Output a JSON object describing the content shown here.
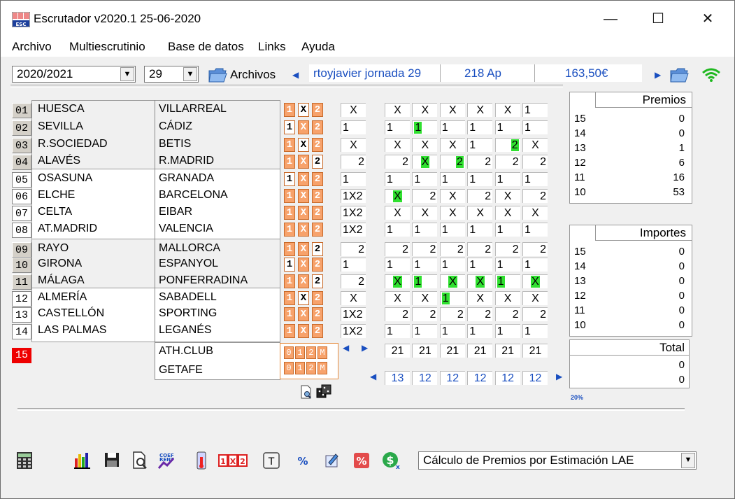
{
  "window": {
    "title": "Escrutador v2020.1 25-06-2020",
    "min": "—",
    "max": "☐",
    "close": "✕"
  },
  "menu": [
    "Archivo",
    "Multiescrutinio",
    "Base de datos",
    "Links",
    "Ayuda"
  ],
  "toolbar": {
    "season": "2020/2021",
    "round": "29",
    "archivos_label": "Archivos",
    "file_name": "rtoyjavier jornada 29",
    "apuestas": "218 Ap",
    "importe": "163,50€"
  },
  "matches": [
    {
      "n": "01",
      "home": "HUESCA",
      "away": "VILLARREAL",
      "sign": "X",
      "col0": "X"
    },
    {
      "n": "02",
      "home": "SEVILLA",
      "away": "CÁDIZ",
      "sign": "1",
      "col0": "1"
    },
    {
      "n": "03",
      "home": "R.SOCIEDAD",
      "away": "BETIS",
      "sign": "X",
      "col0": "X"
    },
    {
      "n": "04",
      "home": "ALAVÉS",
      "away": "R.MADRID",
      "sign": "2",
      "col0": "2"
    },
    {
      "n": "05",
      "home": "OSASUNA",
      "away": "GRANADA",
      "sign": "1",
      "col0": "1"
    },
    {
      "n": "06",
      "home": "ELCHE",
      "away": "BARCELONA",
      "sign": "",
      "col0": "1X2"
    },
    {
      "n": "07",
      "home": "CELTA",
      "away": "EIBAR",
      "sign": "",
      "col0": "1X2"
    },
    {
      "n": "08",
      "home": "AT.MADRID",
      "away": "VALENCIA",
      "sign": "",
      "col0": "1X2"
    },
    {
      "n": "09",
      "home": "RAYO",
      "away": "MALLORCA",
      "sign": "2",
      "col0": "2"
    },
    {
      "n": "10",
      "home": "GIRONA",
      "away": "ESPANYOL",
      "sign": "1",
      "col0": "1"
    },
    {
      "n": "11",
      "home": "MÁLAGA",
      "away": "PONFERRADINA",
      "sign": "2",
      "col0": "2"
    },
    {
      "n": "12",
      "home": "ALMERÍA",
      "away": "SABADELL",
      "sign": "X",
      "col0": "X"
    },
    {
      "n": "13",
      "home": "CASTELLÓN",
      "away": "SPORTING",
      "sign": "",
      "col0": "1X2"
    },
    {
      "n": "14",
      "home": "LAS PALMAS",
      "away": "LEGANÉS",
      "sign": "",
      "col0": "1X2"
    }
  ],
  "pleno": {
    "n": "15",
    "home": "ATH.CLUB",
    "away": "GETAFE",
    "options": [
      "0",
      "1",
      "2",
      "M"
    ]
  },
  "columns": [
    [
      "X",
      "1",
      "X",
      "2",
      "1",
      "X",
      "X",
      "1",
      "2",
      "1",
      "X",
      "X",
      "2",
      "1"
    ],
    [
      "X",
      "1",
      "X",
      "X",
      "1",
      "2",
      "X",
      "1",
      "2",
      "1",
      "1",
      "X",
      "2",
      "1"
    ],
    [
      "X",
      "1",
      "X",
      "2",
      "1",
      "X",
      "X",
      "1",
      "2",
      "1",
      "X",
      "1",
      "2",
      "1"
    ],
    [
      "X",
      "1",
      "1",
      "2",
      "1",
      "2",
      "X",
      "1",
      "2",
      "1",
      "X",
      "X",
      "2",
      "1"
    ],
    [
      "X",
      "1",
      "2",
      "2",
      "1",
      "X",
      "X",
      "1",
      "2",
      "1",
      "1",
      "X",
      "2",
      "1"
    ],
    [
      "1",
      "1",
      "X",
      "2",
      "1",
      "2",
      "X",
      "1",
      "2",
      "1",
      "X",
      "X",
      "2",
      "1"
    ]
  ],
  "highlights": [
    [
      0,
      5
    ],
    [
      1,
      3
    ],
    [
      2,
      3
    ],
    [
      1,
      1
    ],
    [
      2,
      10
    ],
    [
      3,
      10
    ],
    [
      4,
      10
    ],
    [
      5,
      10
    ],
    [
      0,
      10
    ],
    [
      1,
      10
    ],
    [
      2,
      11
    ],
    [
      4,
      2
    ]
  ],
  "col_totals": [
    "21",
    "21",
    "21",
    "21",
    "21",
    "21"
  ],
  "col_hits": [
    "13",
    "12",
    "12",
    "12",
    "12",
    "12"
  ],
  "premios": {
    "title": "Premios",
    "rows": [
      [
        "15",
        "0"
      ],
      [
        "14",
        "0"
      ],
      [
        "13",
        "1"
      ],
      [
        "12",
        "6"
      ],
      [
        "11",
        "16"
      ],
      [
        "10",
        "53"
      ]
    ]
  },
  "importes": {
    "title": "Importes",
    "rows": [
      [
        "15",
        "0"
      ],
      [
        "14",
        "0"
      ],
      [
        "13",
        "0"
      ],
      [
        "12",
        "0"
      ],
      [
        "11",
        "0"
      ],
      [
        "10",
        "0"
      ]
    ]
  },
  "total": {
    "title": "Total",
    "values": [
      "0",
      "0"
    ]
  },
  "percent_small": "20%",
  "calc_select": "Cálculo de Premios por Estimación LAE",
  "toolbar_icons": [
    "calculator-icon",
    "chart-icon",
    "save-icon",
    "preview-icon",
    "coef-rent-icon",
    "thermometer-icon",
    "1x2-icon",
    "t-icon",
    "percent-icon",
    "edit-icon",
    "percent-red-icon",
    "dollar-icon"
  ]
}
